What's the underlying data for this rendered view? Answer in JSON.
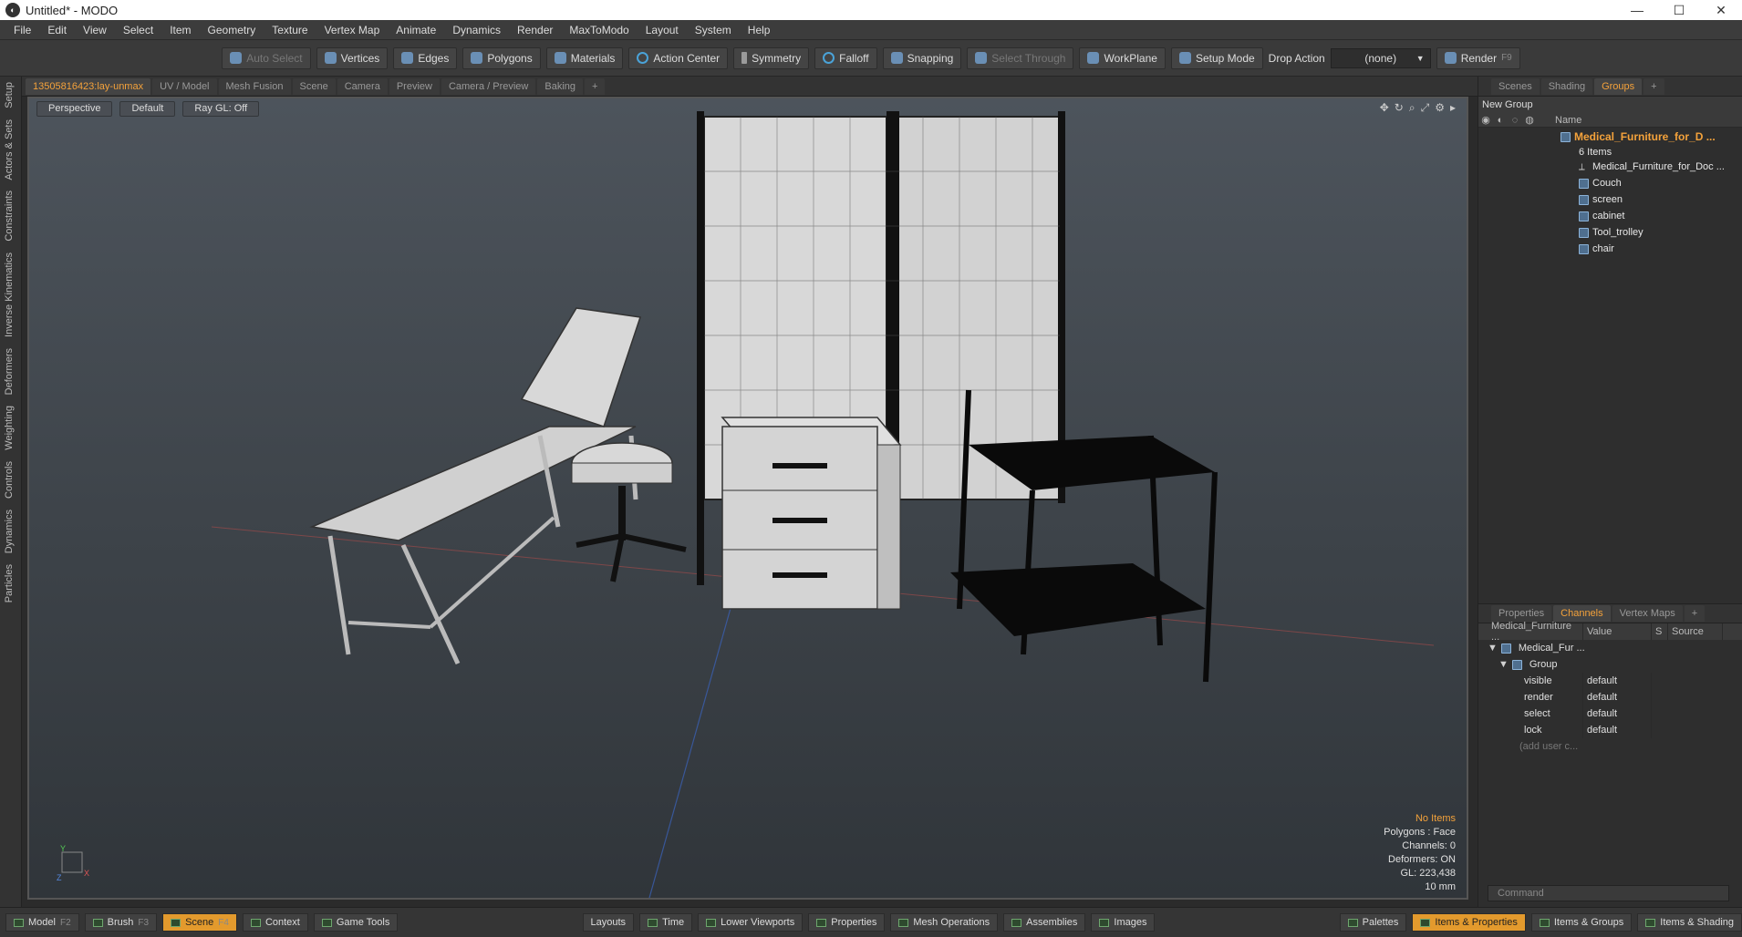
{
  "window": {
    "title": "Untitled* - MODO",
    "controls": [
      "—",
      "☐",
      "✕"
    ]
  },
  "menu": [
    "File",
    "Edit",
    "View",
    "Select",
    "Item",
    "Geometry",
    "Texture",
    "Vertex Map",
    "Animate",
    "Dynamics",
    "Render",
    "MaxToModo",
    "Layout",
    "System",
    "Help"
  ],
  "toolbar": {
    "auto_select": "Auto Select",
    "vertices": "Vertices",
    "edges": "Edges",
    "polygons": "Polygons",
    "materials": "Materials",
    "action_center": "Action Center",
    "symmetry": "Symmetry",
    "falloff": "Falloff",
    "snapping": "Snapping",
    "select_through": "Select Through",
    "workplane": "WorkPlane",
    "setup_mode": "Setup Mode",
    "drop_action": "Drop Action",
    "drop_value": "(none)",
    "render": "Render",
    "render_key": "F9"
  },
  "left_tabs": [
    "Setup",
    "Actors & Sets",
    "Constraints",
    "Inverse Kinematics",
    "Deformers",
    "Weighting",
    "Controls",
    "Dynamics",
    "Particles"
  ],
  "viewport_tabs": [
    "13505816423:lay-unmax",
    "UV / Model",
    "Mesh Fusion",
    "Scene",
    "Camera",
    "Preview",
    "Camera / Preview",
    "Baking",
    "+"
  ],
  "viewport": {
    "view": "Perspective",
    "shading": "Default",
    "raygl": "Ray GL: Off",
    "stats": {
      "items": "No Items",
      "polygons": "Polygons : Face",
      "channels": "Channels: 0",
      "deformers": "Deformers: ON",
      "gl": "GL: 223,438",
      "unit": "10 mm"
    },
    "axis": {
      "y": "Y",
      "x": "X",
      "z": "Z"
    }
  },
  "right_tabs": [
    "Scenes",
    "Shading",
    "Groups",
    "+"
  ],
  "groups": {
    "new_group": "New Group",
    "name_header": "Name",
    "group_name": "Medical_Furniture_for_D ...",
    "item_count": "6 Items",
    "items": [
      {
        "name": "Medical_Furniture_for_Doc ...",
        "icon": "locator-icon"
      },
      {
        "name": "Couch",
        "icon": "mesh-icon"
      },
      {
        "name": "screen",
        "icon": "mesh-icon"
      },
      {
        "name": "cabinet",
        "icon": "mesh-icon"
      },
      {
        "name": "Tool_trolley",
        "icon": "mesh-icon"
      },
      {
        "name": "chair",
        "icon": "mesh-icon"
      }
    ]
  },
  "prop_tabs": [
    "Properties",
    "Channels",
    "Vertex Maps",
    "+"
  ],
  "channels": {
    "headers": [
      "Medical_Furniture ...",
      "Value",
      "S",
      "Source"
    ],
    "root": "Medical_Fur ...",
    "group": "Group",
    "rows": [
      {
        "name": "visible",
        "value": "default"
      },
      {
        "name": "render",
        "value": "default"
      },
      {
        "name": "select",
        "value": "default"
      },
      {
        "name": "lock",
        "value": "default"
      }
    ],
    "add_user": "(add user c..."
  },
  "command_placeholder": "Command",
  "statusbar": {
    "left": [
      {
        "label": "Model",
        "key": "F2"
      },
      {
        "label": "Brush",
        "key": "F3"
      },
      {
        "label": "Scene",
        "key": "F4",
        "active": true
      },
      {
        "label": "Context",
        "key": ""
      },
      {
        "label": "Game Tools",
        "key": ""
      }
    ],
    "center": [
      "Layouts",
      "Time",
      "Lower Viewports",
      "Properties",
      "Mesh Operations",
      "Assemblies",
      "Images"
    ],
    "right": [
      "Palettes",
      "Items & Properties",
      "Items & Groups",
      "Items & Shading"
    ]
  },
  "colors": {
    "accent": "#f4a23b",
    "viewport_top": "#4d545c"
  }
}
